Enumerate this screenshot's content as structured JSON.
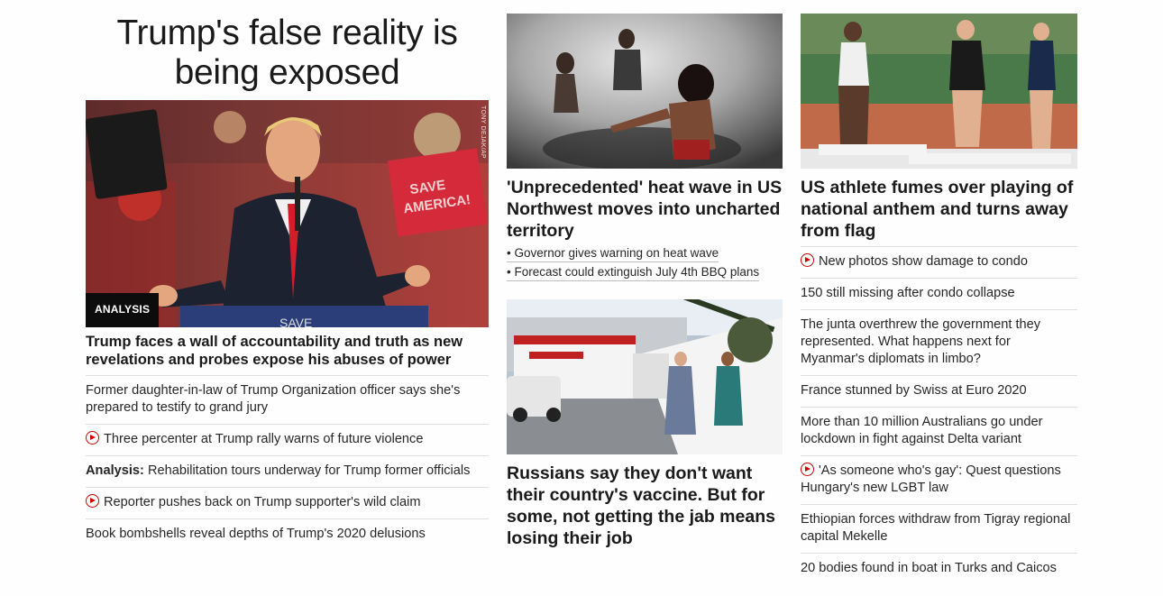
{
  "col1": {
    "headline": "Trump's false reality is being exposed",
    "image_badge": "ANALYSIS",
    "image_credit": "TONY DEJAK/AP",
    "lead_title": "Trump faces a wall of accountability and truth as new revelations and probes expose his abuses of power",
    "items": [
      {
        "text": "Former daughter-in-law of Trump Organization officer says she's prepared to testify to grand jury"
      },
      {
        "text": "Three percenter at Trump rally warns of future violence",
        "icon": "play-icon"
      },
      {
        "prefix": "Analysis:",
        "text": "Rehabilitation tours underway for Trump former officials"
      },
      {
        "text": "Reporter pushes back on Trump supporter's wild claim",
        "icon": "play-icon"
      },
      {
        "text": "Book bombshells reveal depths of Trump's 2020 delusions"
      }
    ]
  },
  "col2": {
    "story1": {
      "title": "'Unprecedented' heat wave in US Northwest moves into uncharted territory",
      "sublinks": [
        "• Governor gives warning on heat wave",
        "• Forecast could extinguish July 4th BBQ plans"
      ]
    },
    "story2": {
      "title": "Russians say they don't want their country's vaccine. But for some, not getting the jab means losing their job"
    }
  },
  "col3": {
    "title": "US athlete fumes over playing of national anthem and turns away from flag",
    "items": [
      {
        "text": "New photos show damage to condo",
        "icon": "play-icon"
      },
      {
        "text": "150 still missing after condo collapse"
      },
      {
        "text": "The junta overthrew the government they represented. What happens next for Myanmar's diplomats in limbo?"
      },
      {
        "text": "France stunned by Swiss at Euro 2020"
      },
      {
        "text": "More than 10 million Australians go under lockdown in fight against Delta variant"
      },
      {
        "text": "'As someone who's gay': Quest questions Hungary's new LGBT law",
        "icon": "play-icon"
      },
      {
        "text": "Ethiopian forces withdraw from Tigray regional capital Mekelle"
      },
      {
        "text": "20 bodies found in boat in Turks and Caicos"
      }
    ]
  },
  "colors": {
    "text": "#262626",
    "accent_red": "#cc0000",
    "divider": "#dedede",
    "badge_bg": "#0c0c0c"
  }
}
